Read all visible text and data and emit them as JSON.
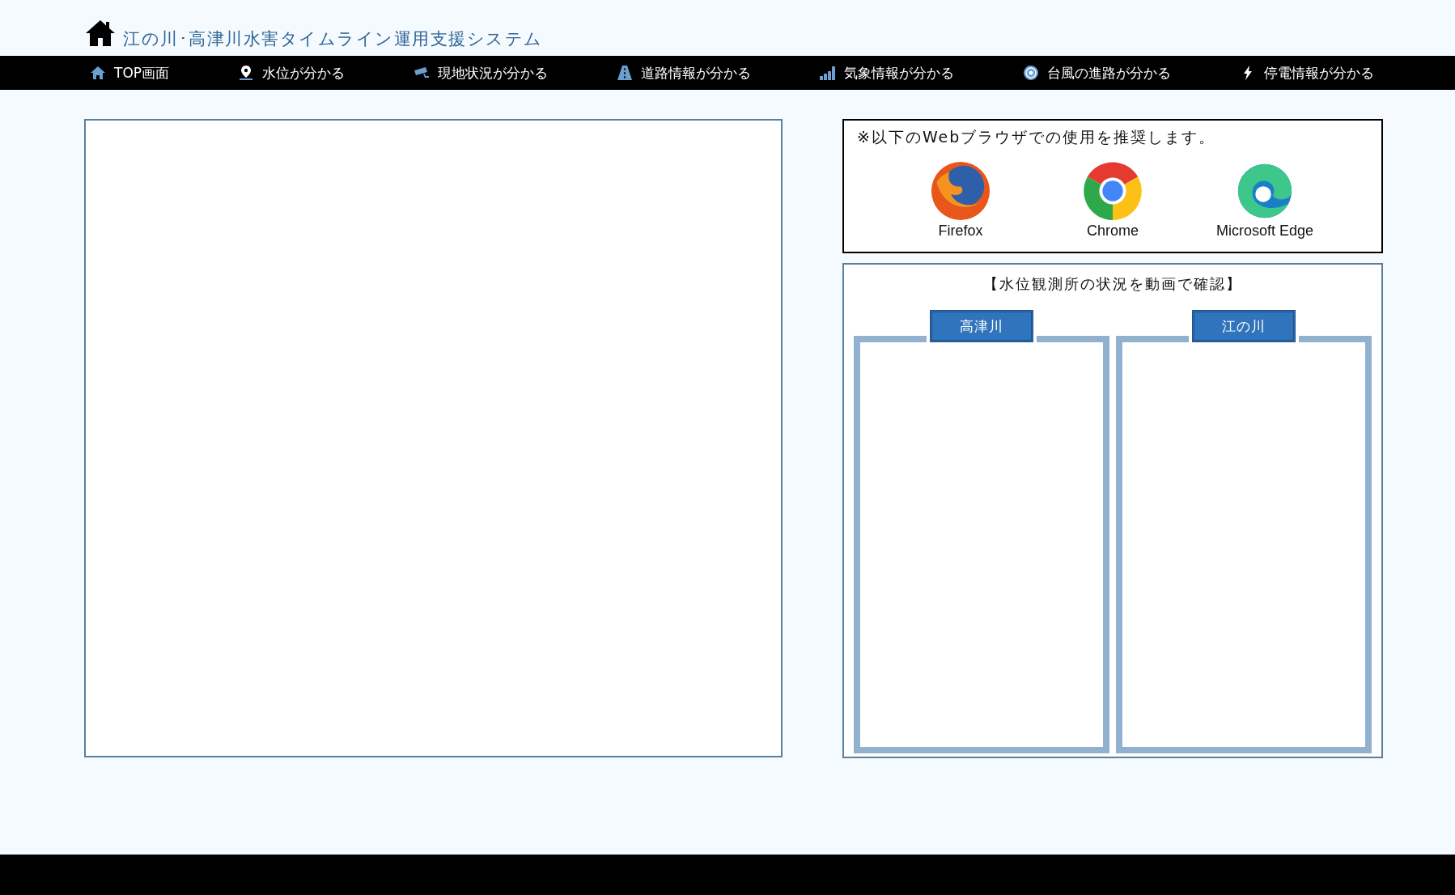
{
  "header": {
    "title": "江の川･高津川水害タイムライン運用支援システム"
  },
  "nav": [
    {
      "label": "TOP画面",
      "kind": "home"
    },
    {
      "label": "水位が分かる",
      "kind": "pin"
    },
    {
      "label": "現地状況が分かる",
      "kind": "camera"
    },
    {
      "label": "道路情報が分かる",
      "kind": "road"
    },
    {
      "label": "気象情報が分かる",
      "kind": "chart"
    },
    {
      "label": "台風の進路が分かる",
      "kind": "typhoon"
    },
    {
      "label": "停電情報が分かる",
      "kind": "bolt"
    }
  ],
  "browser_notice": {
    "text": "※以下のWebブラウザでの使用を推奨します。",
    "browsers": [
      {
        "name": "Firefox",
        "kind": "firefox"
      },
      {
        "name": "Chrome",
        "kind": "chrome"
      },
      {
        "name": "Microsoft Edge",
        "kind": "edge"
      }
    ]
  },
  "video_panel": {
    "title": "【水位観測所の状況を動画で確認】",
    "rivers": [
      {
        "label": "高津川"
      },
      {
        "label": "江の川"
      }
    ]
  }
}
